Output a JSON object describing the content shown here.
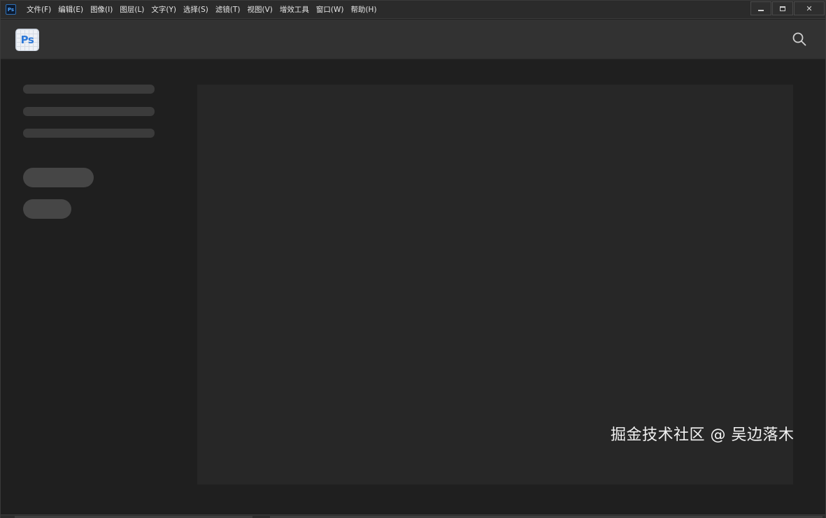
{
  "menubar": {
    "app_icon_text": "Ps",
    "items": [
      {
        "label": "文件(F)"
      },
      {
        "label": "编辑(E)"
      },
      {
        "label": "图像(I)"
      },
      {
        "label": "图层(L)"
      },
      {
        "label": "文字(Y)"
      },
      {
        "label": "选择(S)"
      },
      {
        "label": "滤镜(T)"
      },
      {
        "label": "视图(V)"
      },
      {
        "label": "增效工具"
      },
      {
        "label": "窗口(W)"
      },
      {
        "label": "帮助(H)"
      }
    ],
    "window_controls": {
      "minimize_icon": "minimize-icon",
      "maximize_icon": "maximize-icon",
      "close_label": "✕"
    }
  },
  "header": {
    "logo_text": "Ps",
    "search_icon": "search-icon"
  },
  "watermark": "掘金技术社区 @ 吴边落木",
  "colors": {
    "menubar_bg": "#2b2b2b",
    "header_bg": "#323232",
    "content_bg": "#1f1f1f",
    "panel_bg": "#272727",
    "skeleton": "#3b3b3b",
    "skeleton_pill": "#464646",
    "logo_accent": "#2f7ad9"
  }
}
